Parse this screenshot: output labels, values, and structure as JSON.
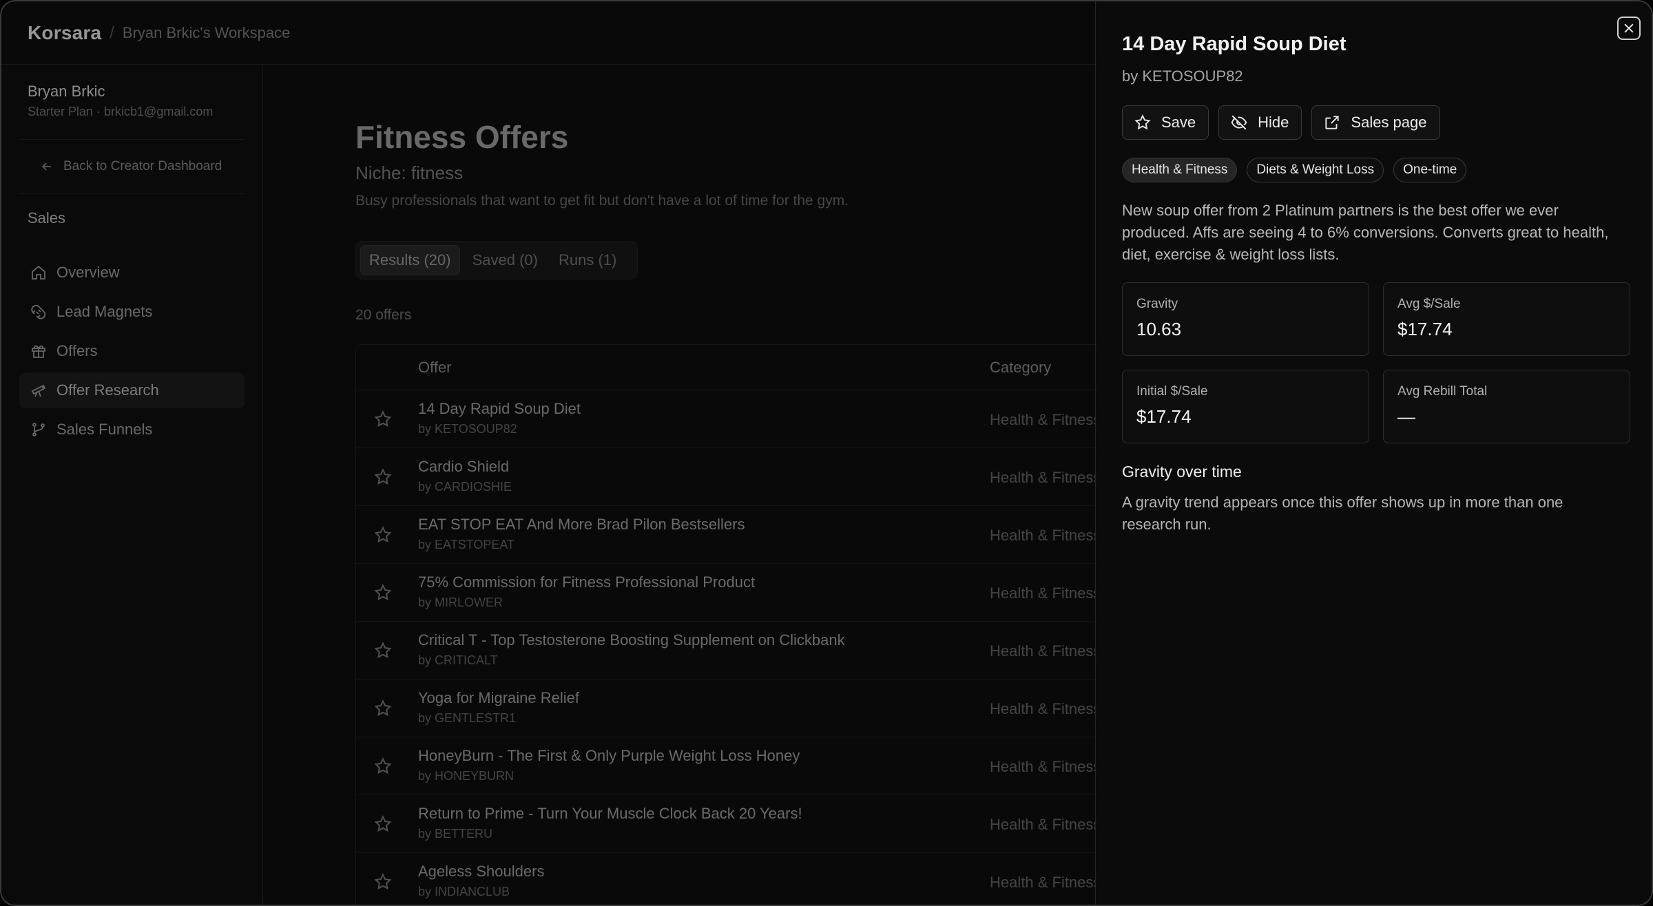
{
  "topbar": {
    "brand": "Korsara",
    "separator": "/",
    "workspace": "Bryan Brkic's Workspace"
  },
  "user": {
    "name": "Bryan Brkic",
    "plan": "Starter Plan · brkicb1@gmail.com"
  },
  "sidebar": {
    "back_label": "Back to Creator Dashboard",
    "section": "Sales",
    "items": [
      {
        "label": "Overview",
        "icon": "home-icon"
      },
      {
        "label": "Lead Magnets",
        "icon": "magnet-icon"
      },
      {
        "label": "Offers",
        "icon": "gift-icon"
      },
      {
        "label": "Offer Research",
        "icon": "telescope-icon",
        "active": true
      },
      {
        "label": "Sales Funnels",
        "icon": "branch-icon"
      }
    ]
  },
  "main": {
    "title": "Fitness Offers",
    "niche": "Niche: fitness",
    "description": "Busy professionals that want to get fit but don't have a lot of time for the gym.",
    "tabs": [
      {
        "label": "Results (20)",
        "active": true
      },
      {
        "label": "Saved (0)"
      },
      {
        "label": "Runs (1)"
      }
    ],
    "count": "20 offers",
    "table": {
      "headers": {
        "offer": "Offer",
        "category": "Category"
      },
      "rows": [
        {
          "title": "14 Day Rapid Soup Diet",
          "by": "by KETOSOUP82",
          "category": "Health & Fitness"
        },
        {
          "title": "Cardio Shield",
          "by": "by CARDIOSHIE",
          "category": "Health & Fitness"
        },
        {
          "title": "EAT STOP EAT And More Brad Pilon Bestsellers",
          "by": "by EATSTOPEAT",
          "category": "Health & Fitness"
        },
        {
          "title": "75% Commission for Fitness Professional Product",
          "by": "by MIRLOWER",
          "category": "Health & Fitness"
        },
        {
          "title": "Critical T - Top Testosterone Boosting Supplement on Clickbank",
          "by": "by CRITICALT",
          "category": "Health & Fitness"
        },
        {
          "title": "Yoga for Migraine Relief",
          "by": "by GENTLESTR1",
          "category": "Health & Fitness"
        },
        {
          "title": "HoneyBurn - The First & Only Purple Weight Loss Honey",
          "by": "by HONEYBURN",
          "category": "Health & Fitness"
        },
        {
          "title": "Return to Prime - Turn Your Muscle Clock Back 20 Years!",
          "by": "by BETTERU",
          "category": "Health & Fitness"
        },
        {
          "title": "Ageless Shoulders",
          "by": "by INDIANCLUB",
          "category": "Health & Fitness"
        }
      ]
    }
  },
  "drawer": {
    "title": "14 Day Rapid Soup Diet",
    "by": "by KETOSOUP82",
    "actions": {
      "save": "Save",
      "hide": "Hide",
      "sales_page": "Sales page"
    },
    "chips": [
      "Health & Fitness",
      "Diets & Weight Loss",
      "One-time"
    ],
    "description": "New soup offer from 2 Platinum partners is the best offer we ever produced. Affs are seeing 4 to 6% conversions. Converts great to health, diet, exercise & weight loss lists.",
    "stats": [
      {
        "label": "Gravity",
        "value": "10.63"
      },
      {
        "label": "Avg $/Sale",
        "value": "$17.74"
      },
      {
        "label": "Initial $/Sale",
        "value": "$17.74"
      },
      {
        "label": "Avg Rebill Total",
        "value": "—"
      }
    ],
    "gravity_title": "Gravity over time",
    "gravity_desc": "A gravity trend appears once this offer shows up in more than one research run."
  }
}
